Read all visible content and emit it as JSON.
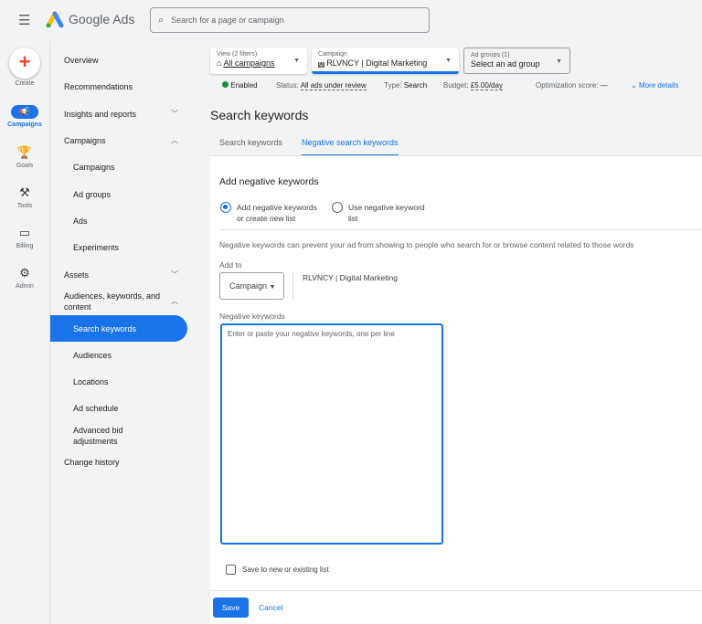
{
  "header": {
    "app_name": "Google Ads",
    "search_placeholder": "Search for a page or campaign"
  },
  "rail": {
    "create": "Create",
    "items": [
      {
        "label": "Campaigns",
        "icon": "megaphone-icon"
      },
      {
        "label": "Goals",
        "icon": "trophy-icon"
      },
      {
        "label": "Tools",
        "icon": "tools-icon"
      },
      {
        "label": "Billing",
        "icon": "card-icon"
      },
      {
        "label": "Admin",
        "icon": "gear-icon"
      }
    ]
  },
  "nav": {
    "items": [
      "Overview",
      "Recommendations",
      "Insights and reports",
      "Campaigns",
      "Campaigns",
      "Ad groups",
      "Ads",
      "Experiments",
      "Assets",
      "Audiences, keywords, and content",
      "Search keywords",
      "Audiences",
      "Locations",
      "Ad schedule",
      "Advanced bid adjustments",
      "Change history"
    ]
  },
  "filters": {
    "view_label": "View (2 filters)",
    "view_value": "All campaigns",
    "campaign_label": "Campaign",
    "campaign_value": "RLVNCY | Digital Marketing",
    "adgroup_label": "Ad groups (1)",
    "adgroup_value": "Select an ad group"
  },
  "status": {
    "enabled": "Enabled",
    "status_label": "Status:",
    "status_value": "All ads under review",
    "type_label": "Type:",
    "type_value": "Search",
    "budget_label": "Budget:",
    "budget_value": "£5.00/day",
    "opt_label": "Optimization score:",
    "opt_value": "—",
    "more": "More details",
    "enabled_color": "#1e8e3e"
  },
  "page": {
    "title": "Search keywords",
    "tabs": [
      "Search keywords",
      "Negative search keywords"
    ]
  },
  "form": {
    "heading": "Add negative keywords",
    "radio1": "Add negative keywords or create new list",
    "radio2": "Use negative keyword list",
    "help": "Negative keywords can prevent your ad from showing to people who search for or browse content related to those words",
    "add_to": "Add to",
    "add_to_select": "Campaign",
    "add_to_target": "RLVNCY | Digital Marketing",
    "kw_label": "Negative keywords",
    "kw_placeholder": "Enter or paste your negative keywords, one per line",
    "save_list": "Save to new or existing list",
    "save": "Save",
    "cancel": "Cancel"
  }
}
